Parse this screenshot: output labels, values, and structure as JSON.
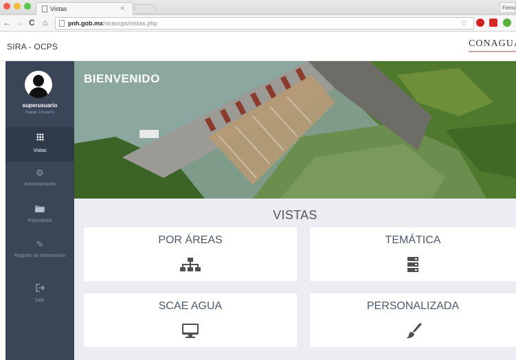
{
  "browser": {
    "tab_title": "Vistas",
    "tab_close": "×",
    "user_badge": "Ferna",
    "url_host": "pnh.gob.mx",
    "url_path": "/siraocps/vistas.php"
  },
  "app": {
    "brand": "SIRA - OCPS",
    "logo_text": "CONAGUA"
  },
  "sidebar": {
    "username": "superusuario",
    "role": "Super Usuario",
    "items": [
      {
        "label": "Vistas",
        "icon": "grid-icon",
        "active": true
      },
      {
        "label": "Administración",
        "icon": "gear-icon",
        "active": false
      },
      {
        "label": "Repositorio",
        "icon": "folder-icon",
        "active": false
      },
      {
        "label": "Registro de Información",
        "icon": "pencil-icon",
        "active": false
      },
      {
        "label": "Salir",
        "icon": "sign-out-icon",
        "active": false
      }
    ]
  },
  "hero": {
    "title": "BIENVENIDO"
  },
  "main": {
    "section_title": "VISTAS",
    "cards": [
      {
        "label": "POR ÁREAS",
        "icon": "sitemap-icon"
      },
      {
        "label": "TEMÁTICA",
        "icon": "server-icon"
      },
      {
        "label": "SCAE AGUA",
        "icon": "desktop-icon"
      },
      {
        "label": "PERSONALIZADA",
        "icon": "paintbrush-icon"
      }
    ]
  },
  "colors": {
    "sidebar": "#3a4658",
    "content_bg": "#ecedf2",
    "card_text": "#4a5a6a"
  }
}
